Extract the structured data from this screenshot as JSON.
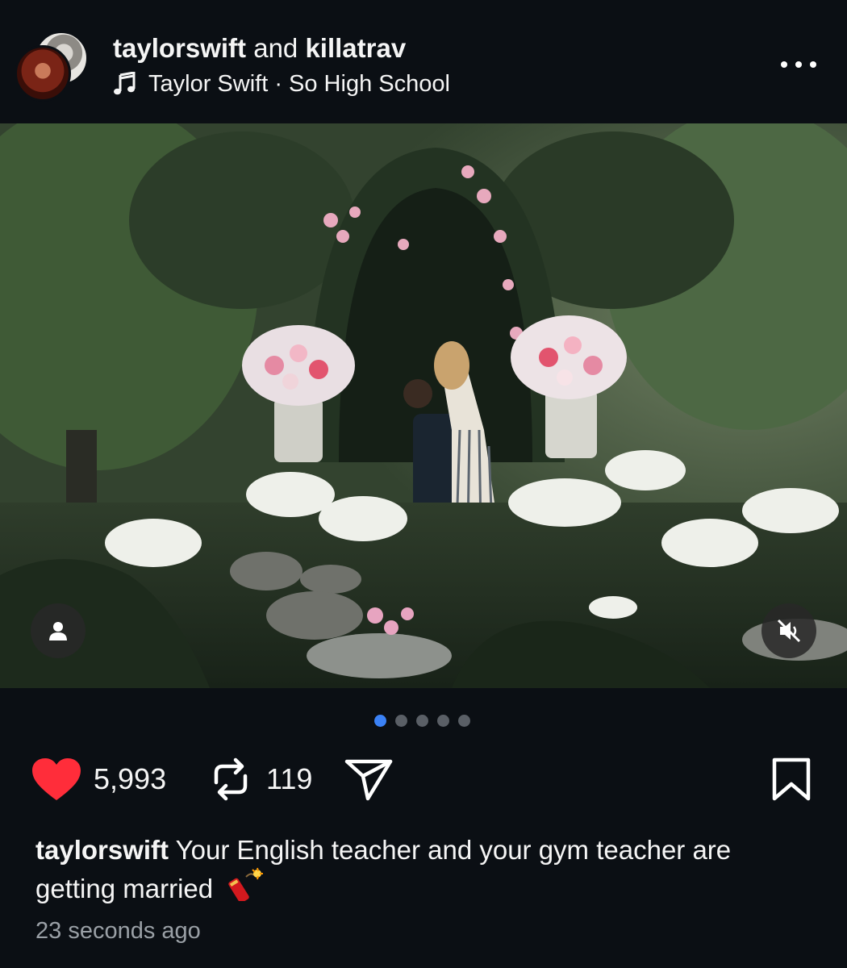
{
  "post": {
    "author_primary": "taylorswift",
    "connector": "and",
    "author_secondary": "killatrav",
    "music": "Taylor Swift · So High School",
    "more_icon": "more-horizontal-icon"
  },
  "media": {
    "carousel_total": 5,
    "carousel_index": 1,
    "user_tag_icon": "person-icon",
    "audio_icon": "speaker-muted-icon"
  },
  "actions": {
    "likes": "5,993",
    "reposts": "119",
    "like_icon": "heart-filled-icon",
    "repost_icon": "repost-icon",
    "share_icon": "send-icon",
    "save_icon": "bookmark-icon"
  },
  "caption": {
    "username": "taylorswift",
    "text": "Your English teacher and your gym teacher are getting married",
    "emoji": "firecracker"
  },
  "timestamp": "23 seconds ago",
  "colors": {
    "background": "#0b0f14",
    "like": "#ff2d3a",
    "active_dot": "#3b82f6"
  }
}
